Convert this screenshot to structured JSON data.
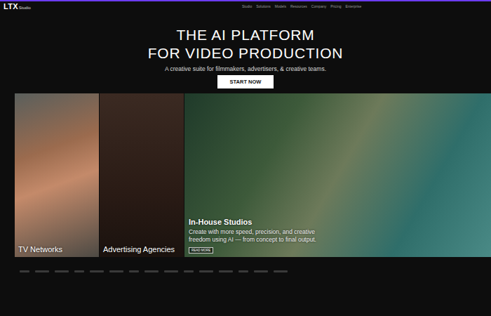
{
  "header": {
    "logo": "LTX",
    "logo_suffix": "Studio",
    "nav": [
      "Studio",
      "Solutions",
      "Models",
      "Resources",
      "Company",
      "Pricing",
      "Enterprise"
    ]
  },
  "hero": {
    "title_lines": [
      "THE AI PLATFORM",
      "FOR VIDEO PRODUCTION"
    ],
    "subtitle": "A creative suite for filmmakers, advertisers, & creative teams.",
    "button": "START NOW"
  },
  "cards": [
    {
      "kind": "small",
      "label": "TV Networks",
      "description": "",
      "button": ""
    },
    {
      "kind": "small",
      "label": "Advertising Agencies",
      "description": "",
      "button": ""
    },
    {
      "kind": "featured",
      "label": "In-House Studios",
      "description": "Create with more speed, precision, and creative freedom using AI — from concept to final output.",
      "button": "READ MORE"
    }
  ]
}
